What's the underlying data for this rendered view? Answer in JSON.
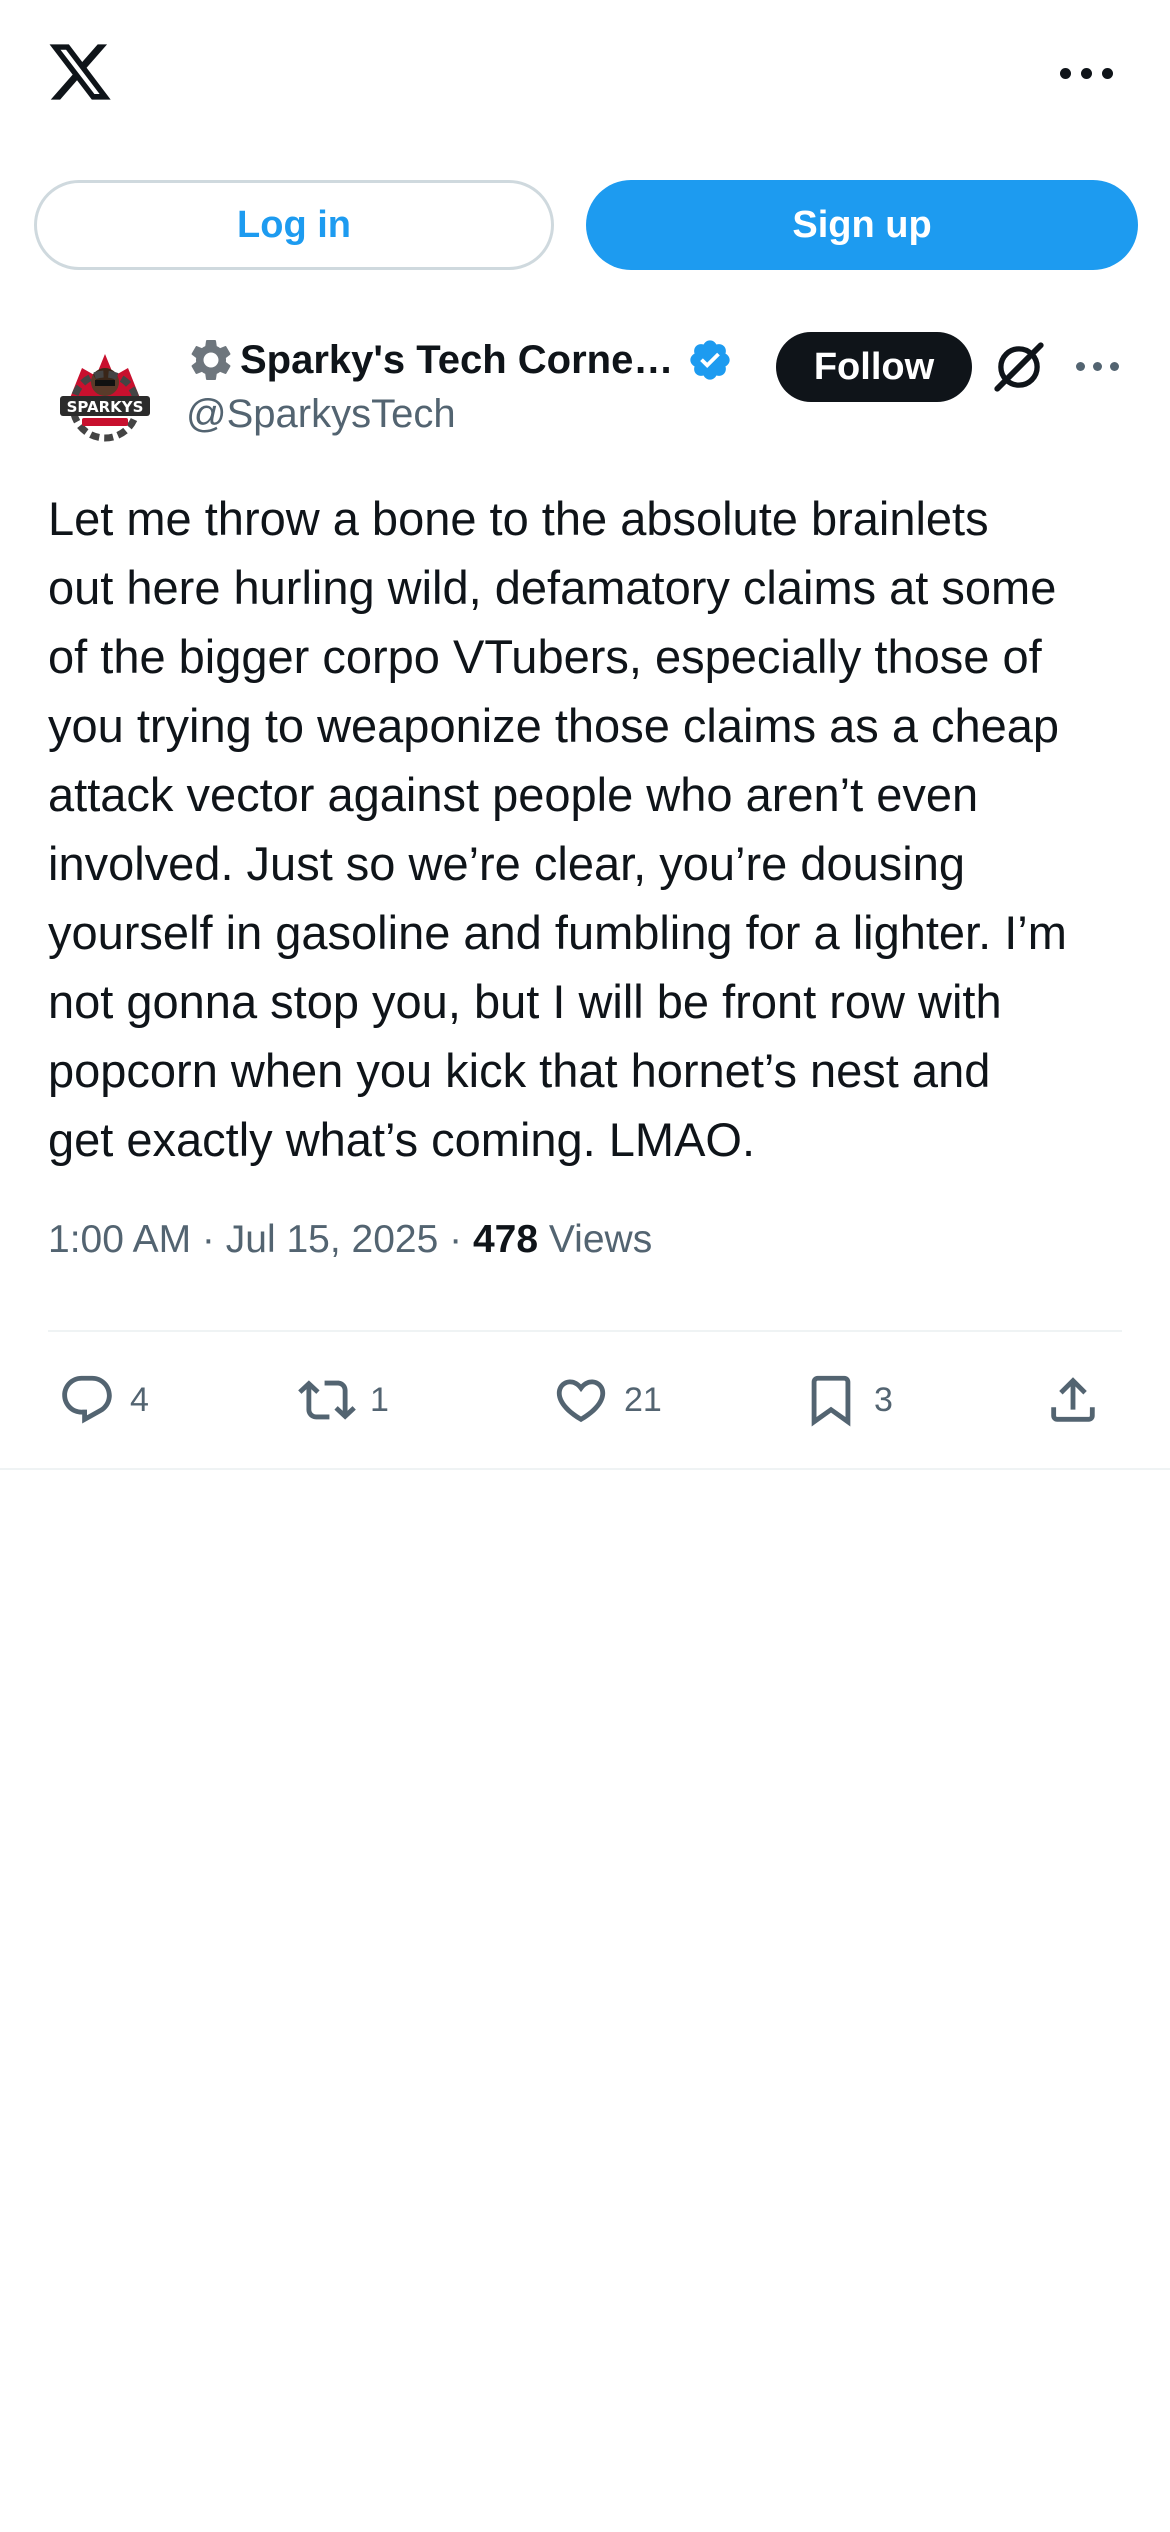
{
  "header": {
    "logo_icon": "x-logo-icon",
    "more_icon": "more-horizontal-icon"
  },
  "auth": {
    "login_label": "Log in",
    "signup_label": "Sign up"
  },
  "author": {
    "gear_icon": "gear-icon",
    "display_name": "Sparky's Tech Corne…",
    "verified_icon": "verified-badge-icon",
    "verified_color": "#1d9bf0",
    "handle": "@SparkysTech",
    "follow_label": "Follow",
    "grok_icon": "grok-icon",
    "more_icon": "more-horizontal-icon"
  },
  "tweet": {
    "text": "Let me throw a bone to the absolute brainlets\nout here hurling wild, defamatory claims at some\nof the bigger corpo VTubers, especially those of\nyou trying to weaponize those claims as a cheap\nattack vector against people who aren’t even\ninvolved. Just so we’re clear, you’re dousing\nyourself in gasoline and fumbling for a lighter. I’m\nnot gonna stop you, but I will be front row with\npopcorn when you kick that hornet’s nest and\nget exactly what’s coming. LMAO.",
    "time": "1:00 AM",
    "date": "Jul 15, 2025",
    "separator": " · ",
    "views_count": "478",
    "views_label": "Views"
  },
  "actions": {
    "reply": {
      "icon": "reply-icon",
      "count": "4"
    },
    "repost": {
      "icon": "repost-icon",
      "count": "1"
    },
    "like": {
      "icon": "heart-icon",
      "count": "21"
    },
    "bookmark": {
      "icon": "bookmark-icon",
      "count": "3"
    },
    "share": {
      "icon": "share-icon"
    }
  },
  "colors": {
    "accent": "#1d9bf0",
    "text": "#0f1419",
    "secondary_text": "#536471"
  }
}
